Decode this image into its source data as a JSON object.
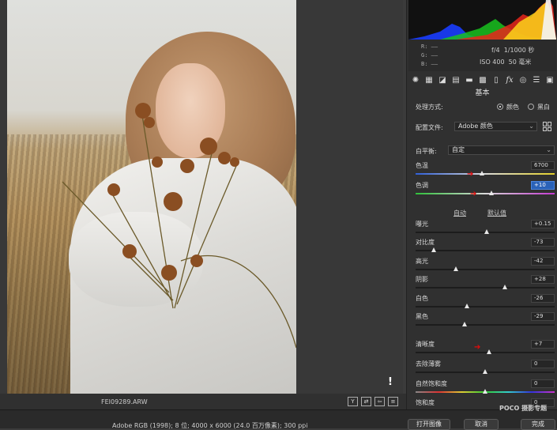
{
  "canvas": {
    "filename": "FEI09289.ARW",
    "warning_icon": "warning-icon"
  },
  "histogram": {
    "r_label": "R:",
    "g_label": "G:",
    "b_label": "B:",
    "r_value": "——",
    "g_value": "——",
    "b_value": "——"
  },
  "exif": {
    "aperture": "f/4",
    "shutter": "1/1000 秒",
    "iso": "ISO 400",
    "focal": "50 毫米"
  },
  "toolbar": {
    "tools": [
      "aperture-icon",
      "grid-icon",
      "curve-icon",
      "hsl-icon",
      "split-tone-icon",
      "detail-icon",
      "lens-icon",
      "fx-icon",
      "calibration-icon",
      "presets-icon",
      "snapshot-icon"
    ]
  },
  "basic": {
    "title": "基本",
    "process_label": "处理方式:",
    "process_options": [
      "颜色",
      "黑白"
    ],
    "profile_label": "配置文件:",
    "profile_value": "Adobe 颜色",
    "wb_label": "白平衡:",
    "wb_value": "自定",
    "auto_label": "自动",
    "default_label": "默认值",
    "sliders": [
      {
        "label": "色温",
        "value": "6700",
        "pos": 0.52,
        "arrow": true
      },
      {
        "label": "色调",
        "value": "+10",
        "pos": 0.56,
        "arrow": true
      },
      {
        "label": "曝光",
        "value": "+0.15",
        "pos": 0.51
      },
      {
        "label": "对比度",
        "value": "-73",
        "pos": 0.13
      },
      {
        "label": "高光",
        "value": "-42",
        "pos": 0.29
      },
      {
        "label": "阴影",
        "value": "+28",
        "pos": 0.64
      },
      {
        "label": "白色",
        "value": "-26",
        "pos": 0.37
      },
      {
        "label": "黑色",
        "value": "-29",
        "pos": 0.36
      },
      {
        "label": "清晰度",
        "value": "+7",
        "pos": 0.53,
        "arrow": true
      },
      {
        "label": "去除薄雾",
        "value": "0",
        "pos": 0.5
      },
      {
        "label": "自然饱和度",
        "value": "0",
        "pos": 0.5
      },
      {
        "label": "饱和度",
        "value": "0",
        "pos": 0.5
      }
    ]
  },
  "bottom": {
    "colorspace": "Adobe RGB (1998); 8 位; 4000 x 6000 (24.0 百万像素); 300 ppi",
    "open_label": "打开图像",
    "cancel_label": "取消",
    "done_label": "完成",
    "view_buttons": [
      "Y",
      "⇄",
      "⇦",
      "≡"
    ]
  },
  "watermark": "POCO 摄影专题",
  "colors": {
    "arrow": "#e20a0a",
    "selected_field": "#2a62b8"
  }
}
